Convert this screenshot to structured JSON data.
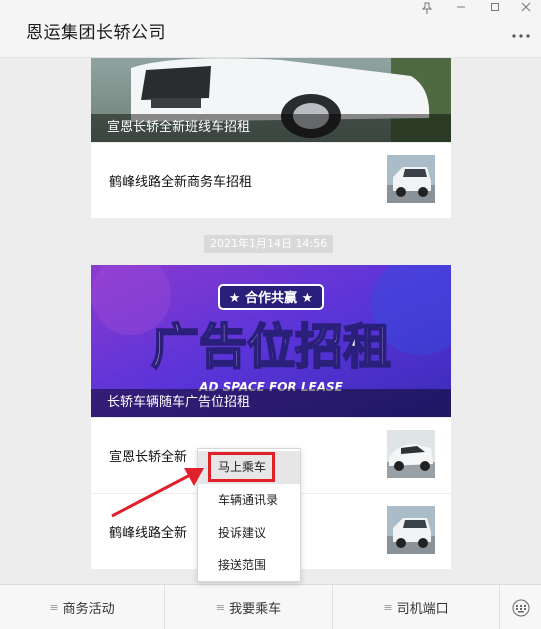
{
  "window": {
    "title": "恩运集团长轿公司",
    "pin_icon": "pin-icon",
    "minimize_icon": "minimize-icon",
    "maximize_icon": "maximize-icon",
    "close_icon": "close-icon",
    "more_icon": "more-dots-icon"
  },
  "cards": [
    {
      "cover_caption": "宣恩长轿全新班线车招租",
      "articles": [
        {
          "title": "鹤峰线路全新商务车招租"
        }
      ]
    },
    {
      "timestamp": "2021年1月14日 14:56",
      "cover_caption": "长轿车辆随车广告位招租",
      "cover_badge": "合作共赢",
      "cover_headline": "广告位招租",
      "cover_sub": "AD SPACE FOR LEASE",
      "articles": [
        {
          "title": "宣恩长轿全新"
        },
        {
          "title": "鹤峰线路全新"
        }
      ]
    }
  ],
  "popup_menu": {
    "items": [
      "马上乘车",
      "车辆通讯录",
      "投诉建议",
      "接送范围"
    ],
    "active_index": 0
  },
  "bottom_menu": {
    "items": [
      "商务活动",
      "我要乘车",
      "司机端口"
    ],
    "keyboard_icon": "keyboard-icon"
  },
  "colors": {
    "highlight": "#e0202b",
    "cover_purple": "#6b3fd6"
  }
}
